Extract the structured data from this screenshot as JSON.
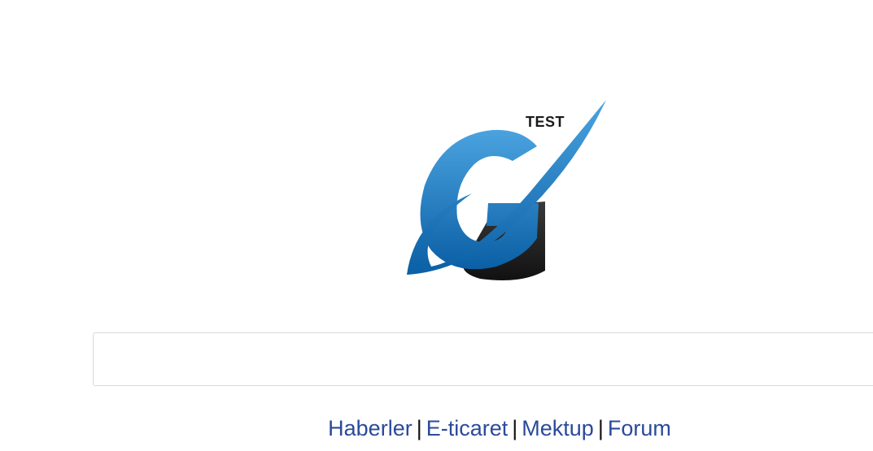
{
  "logo": {
    "text": "TEST",
    "icon": "g-swoosh-logo-icon",
    "colors": {
      "blue_light": "#4aa3df",
      "blue_dark": "#0b5fa5",
      "black": "#1c1c1c"
    }
  },
  "search": {
    "value": "",
    "placeholder": ""
  },
  "nav": {
    "links": [
      "Haberler",
      "E-ticaret",
      "Mektup",
      "Forum"
    ],
    "separator": "|",
    "link_color": "#2b4a9b"
  }
}
